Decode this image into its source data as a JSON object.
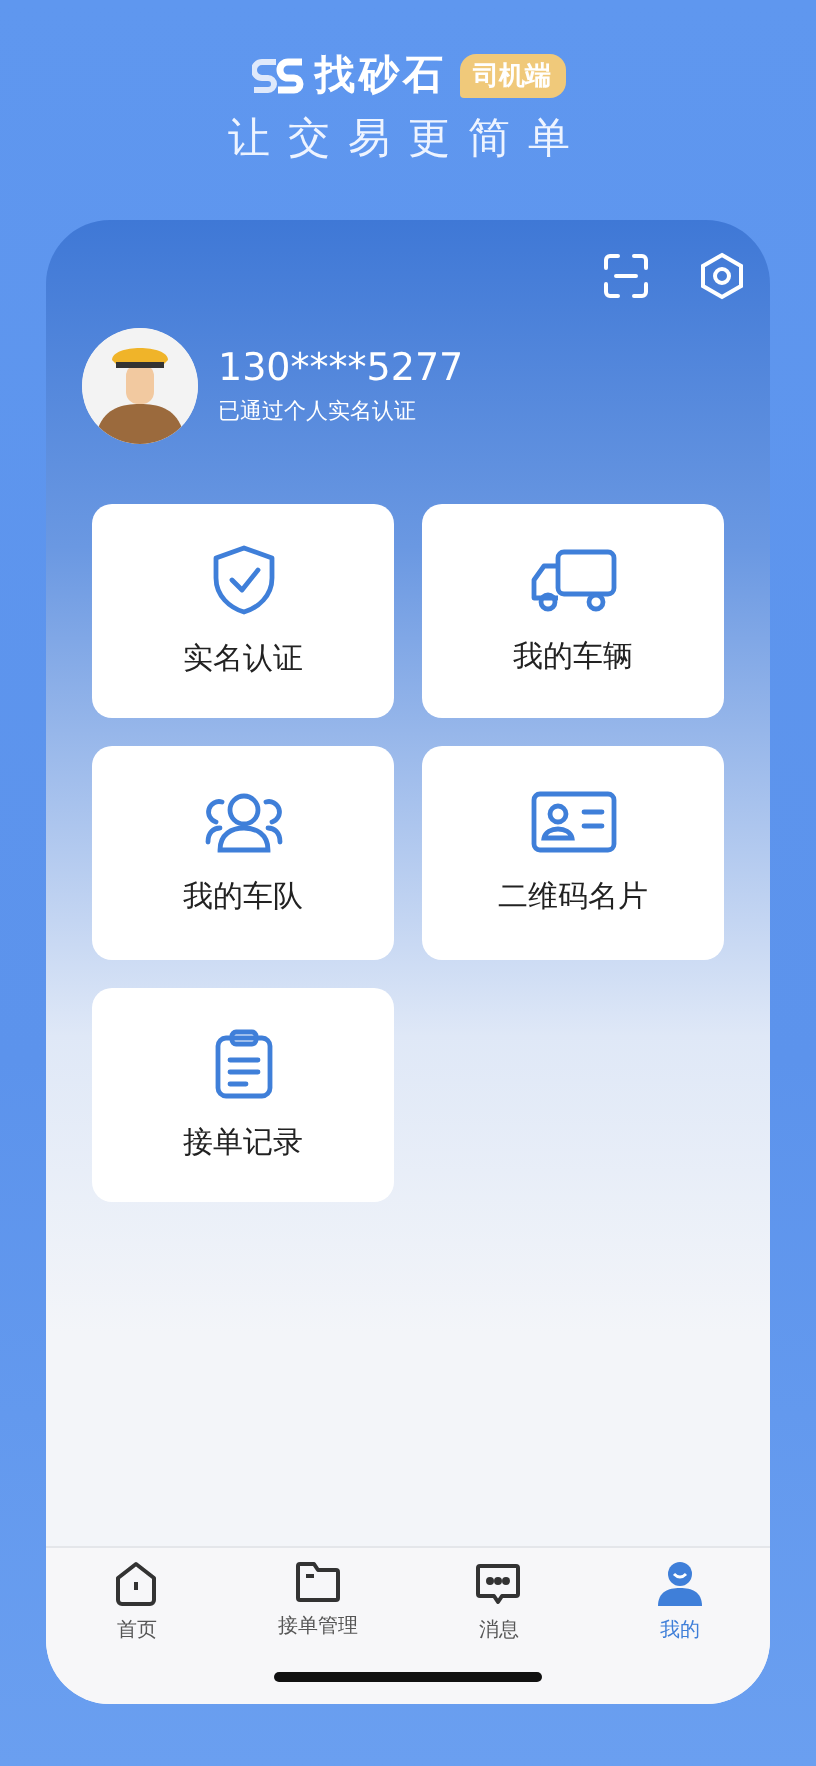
{
  "header": {
    "brand": "找砂石",
    "badge": "司机端",
    "slogan": "让交易更简单"
  },
  "profile": {
    "phone": "130****5277",
    "status": "已通过个人实名认证"
  },
  "tiles": [
    {
      "label": "实名认证",
      "kind": "shield"
    },
    {
      "label": "我的车辆",
      "kind": "truck"
    },
    {
      "label": "我的车队",
      "kind": "team"
    },
    {
      "label": "二维码名片",
      "kind": "card"
    },
    {
      "label": "接单记录",
      "kind": "clipboard"
    }
  ],
  "nav": [
    {
      "label": "首页",
      "kind": "home",
      "selected": false
    },
    {
      "label": "接单管理",
      "kind": "folder",
      "selected": false
    },
    {
      "label": "消息",
      "kind": "message",
      "selected": false
    },
    {
      "label": "我的",
      "kind": "person",
      "selected": true
    }
  ]
}
